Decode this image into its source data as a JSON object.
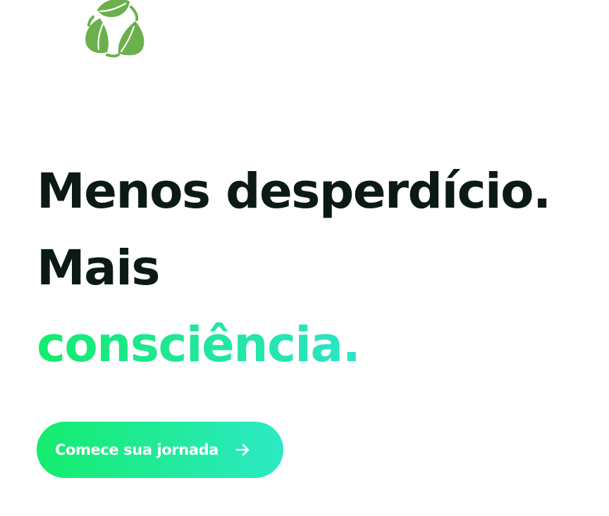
{
  "brand": {
    "logo_icon": "recycle-leaves-icon",
    "logo_color": "#6ab04c"
  },
  "hero": {
    "line1": "Menos desperdício.",
    "line2": "Mais",
    "line3": "consciência.",
    "text_color": "#0b1a17",
    "accent_gradient": [
      "#14eb6e",
      "#2de3c8"
    ]
  },
  "cta": {
    "label": "Comece sua jornada",
    "icon": "arrow-right-icon"
  }
}
